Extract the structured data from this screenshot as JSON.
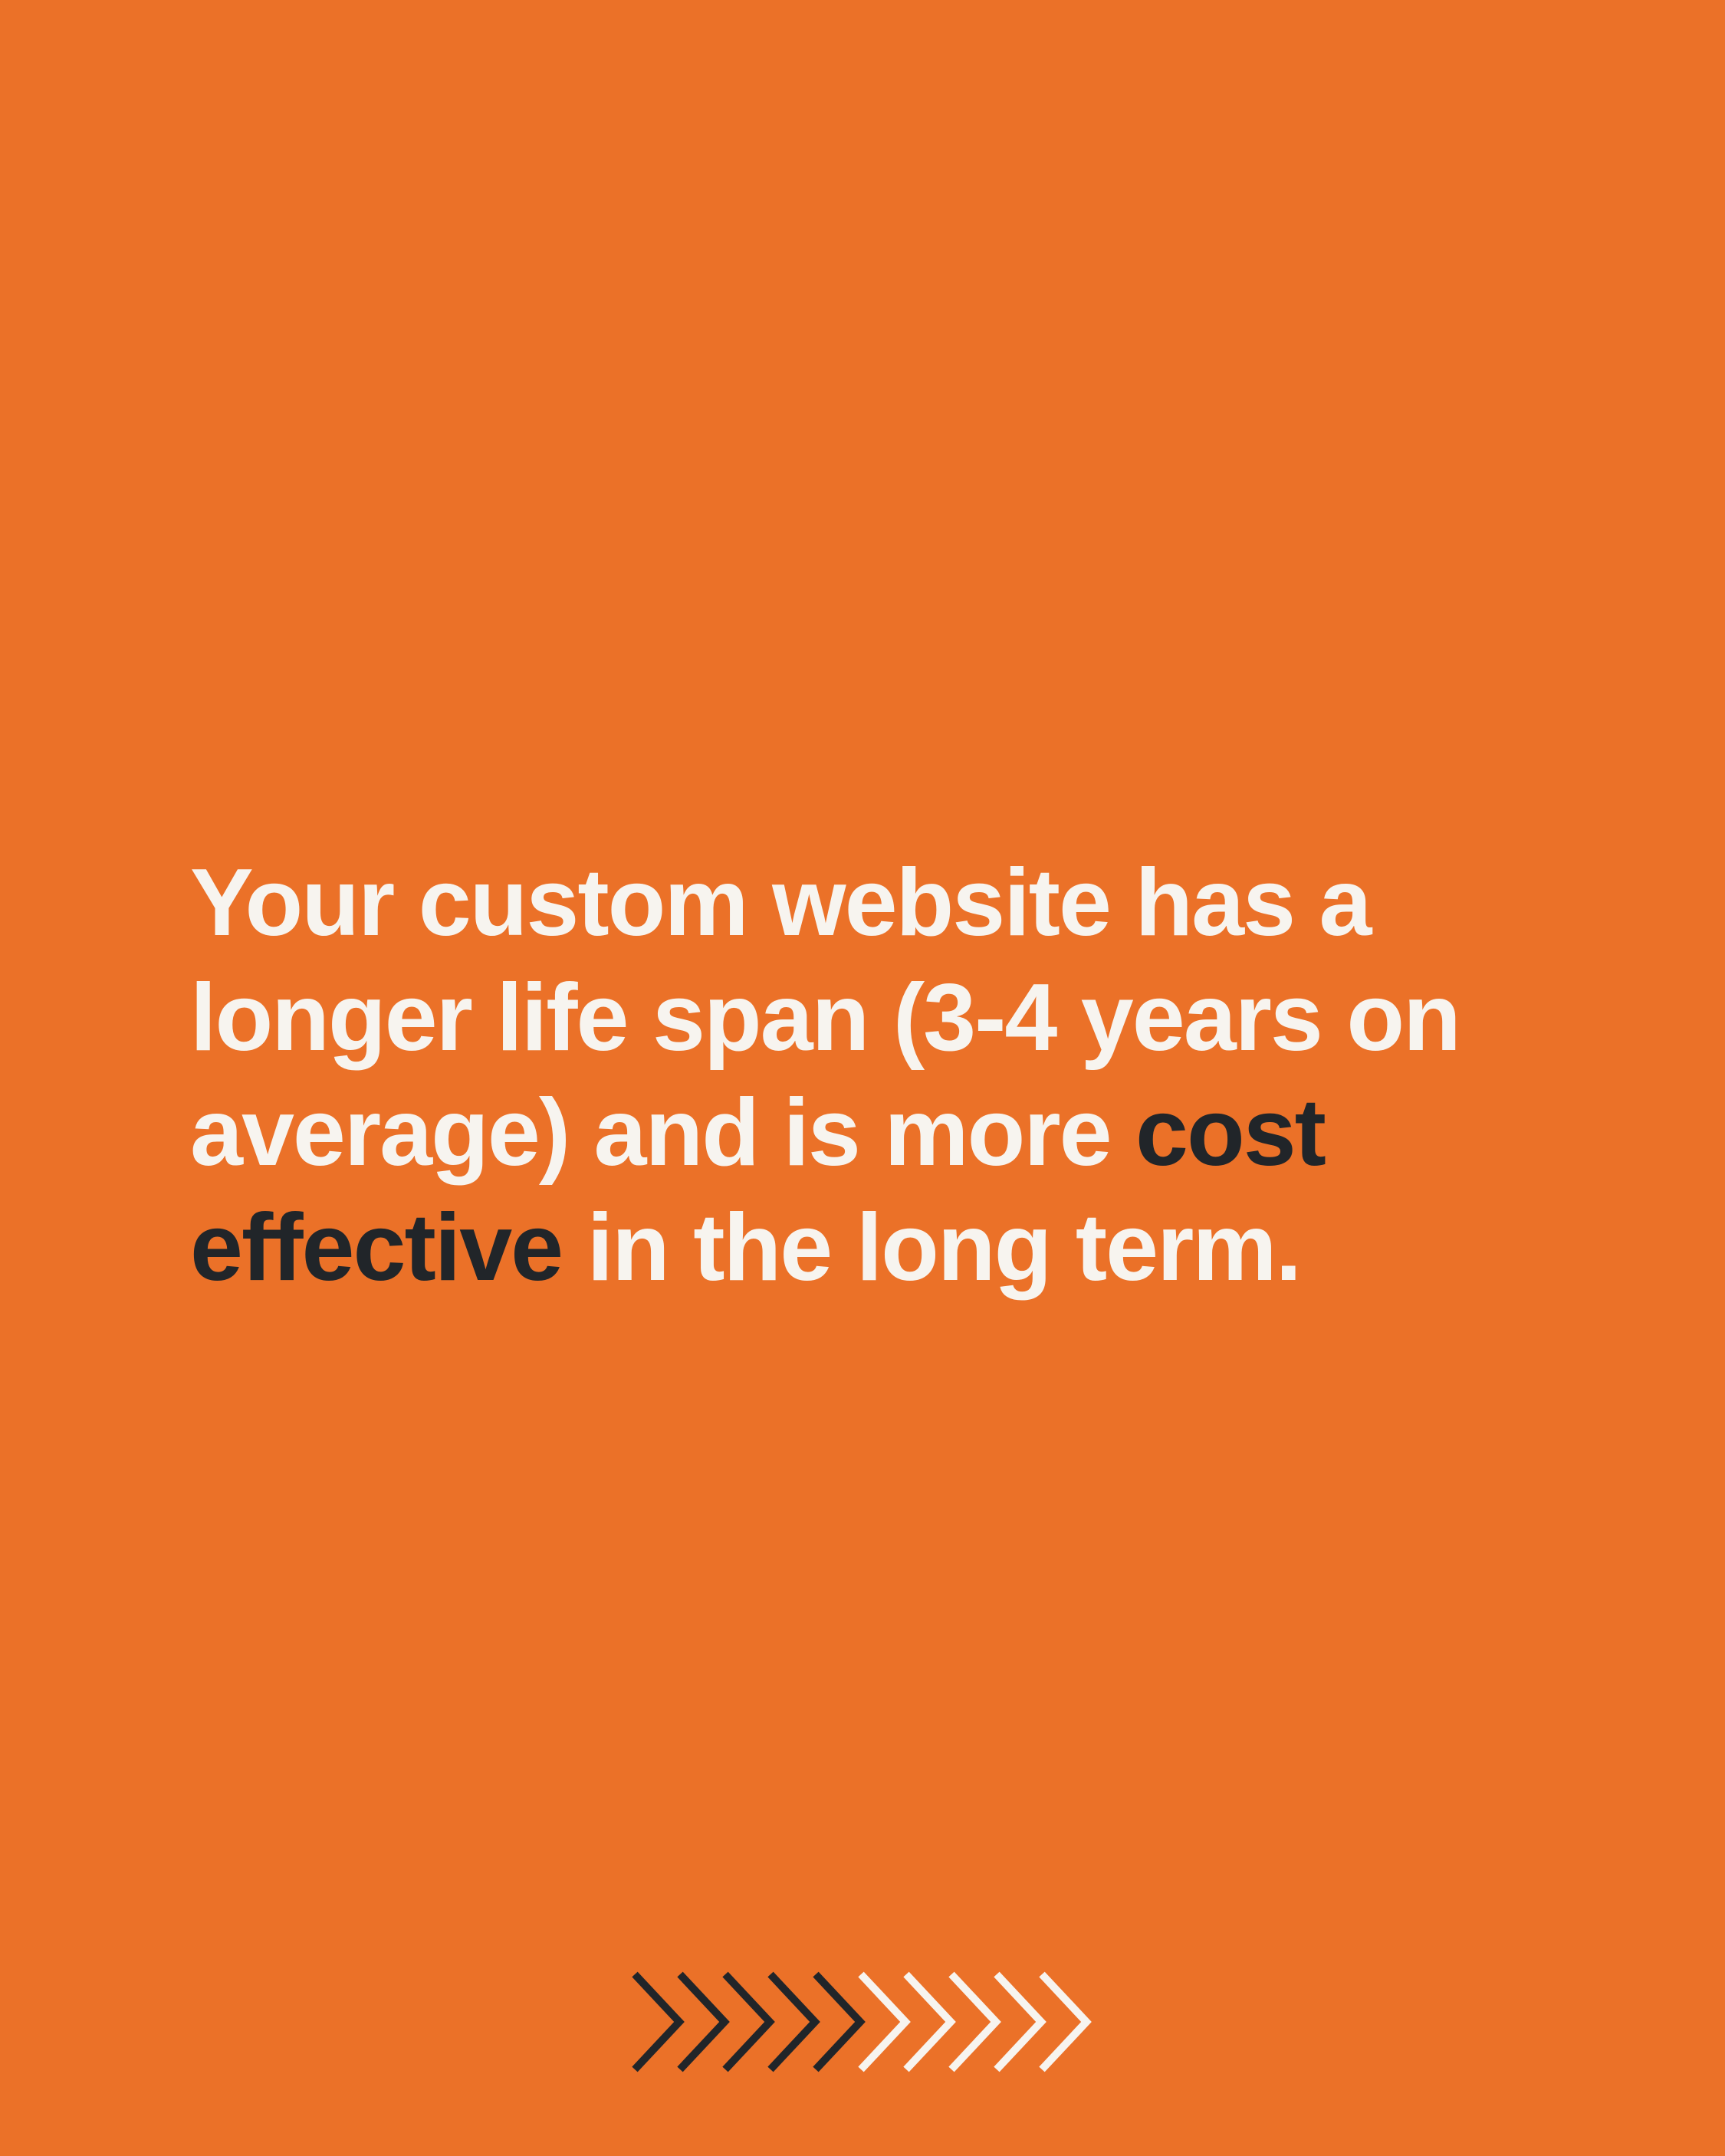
{
  "headline": {
    "line1": "Your custom website has a",
    "line2": "longer life span (3-4 years on",
    "line3_start": "average) and is more ",
    "line3_accent": "cost",
    "line4_accent": "effective",
    "line4_end": " in the long term."
  },
  "colors": {
    "background": "#EB7128",
    "text": "#F7F4EF",
    "accent": "#212529",
    "chevron_dark": "#212529",
    "chevron_light": "#F7F4EF"
  },
  "decoration": {
    "chevrons": [
      {
        "icon": "chevron-right-icon",
        "color": "dark"
      },
      {
        "icon": "chevron-right-icon",
        "color": "dark"
      },
      {
        "icon": "chevron-right-icon",
        "color": "dark"
      },
      {
        "icon": "chevron-right-icon",
        "color": "dark"
      },
      {
        "icon": "chevron-right-icon",
        "color": "dark"
      },
      {
        "icon": "chevron-right-icon",
        "color": "light"
      },
      {
        "icon": "chevron-right-icon",
        "color": "light"
      },
      {
        "icon": "chevron-right-icon",
        "color": "light"
      },
      {
        "icon": "chevron-right-icon",
        "color": "light"
      },
      {
        "icon": "chevron-right-icon",
        "color": "light"
      }
    ]
  }
}
